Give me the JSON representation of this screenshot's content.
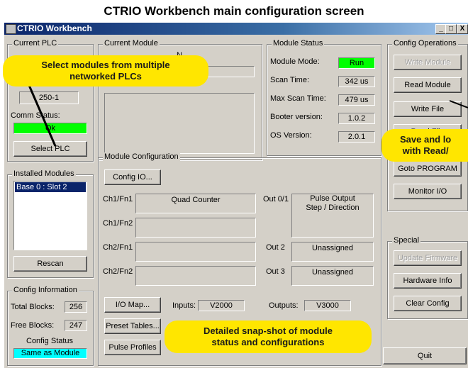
{
  "caption": "CTRIO Workbench main configuration screen",
  "window": {
    "title": "CTRIO Workbench",
    "controls": [
      "_",
      "□",
      "X"
    ]
  },
  "current_plc": {
    "legend": "Current PLC",
    "plc_value": "250-1",
    "comm_status_label": "Comm Status:",
    "comm_status_value": "Ok",
    "select_plc_button": "Select PLC"
  },
  "installed_modules": {
    "legend": "Installed Modules",
    "items": [
      "Base 0 : Slot 2"
    ],
    "rescan_button": "Rescan"
  },
  "config_information": {
    "legend": "Config Information",
    "total_blocks_label": "Total Blocks:",
    "total_blocks_value": "256",
    "free_blocks_label": "Free Blocks:",
    "free_blocks_value": "247",
    "config_status_label": "Config Status",
    "config_status_value": "Same as Module"
  },
  "current_module": {
    "legend": "Current Module",
    "fragment": "N"
  },
  "module_status": {
    "legend": "Module Status",
    "rows": [
      {
        "label": "Module Mode:",
        "value": "Run"
      },
      {
        "label": "Scan Time:",
        "value": "342 us"
      },
      {
        "label": "Max Scan Time:",
        "value": "479 us"
      },
      {
        "label": "Booter version:",
        "value": "1.0.2"
      },
      {
        "label": "OS Version:",
        "value": "2.0.1"
      }
    ]
  },
  "module_configuration": {
    "legend": "Module Configuration",
    "config_io_button": "Config IO...",
    "functions": [
      {
        "label": "Ch1/Fn1",
        "value": "Quad Counter"
      },
      {
        "label": "Ch1/Fn2",
        "value": ""
      },
      {
        "label": "Ch2/Fn1",
        "value": ""
      },
      {
        "label": "Ch2/Fn2",
        "value": ""
      }
    ],
    "outputs": [
      {
        "label": "Out 0/1",
        "value": "Pulse Output\nStep / Direction"
      },
      {
        "label": "Out 2",
        "value": "Unassigned"
      },
      {
        "label": "Out 3",
        "value": "Unassigned"
      }
    ],
    "io_map_button": "I/O Map...",
    "inputs_label": "Inputs:",
    "inputs_value": "V2000",
    "outputs_label": "Outputs:",
    "outputs_value": "V3000",
    "preset_tables_button": "Preset Tables...",
    "pulse_profiles_button": "Pulse Profiles"
  },
  "config_operations": {
    "legend": "Config Operations",
    "buttons": [
      "Write Module",
      "Read Module",
      "Write File",
      "Read File",
      "Goto PROGRAM",
      "Monitor I/O"
    ]
  },
  "special": {
    "legend": "Special",
    "buttons": [
      "Update Firmware",
      "Hardware Info",
      "Clear Config"
    ]
  },
  "quit_button": "Quit",
  "callouts": {
    "plc": "Select modules from multiple\nnetworked PLCs",
    "save": "Save and lo\nwith Read/",
    "status": "Detailed snap-shot of module\nstatus and configurations"
  },
  "colors": {
    "status_ok": "#00ff00",
    "config_same": "#00ffff",
    "callout": "#ffe600",
    "selection": "#0a246a"
  }
}
